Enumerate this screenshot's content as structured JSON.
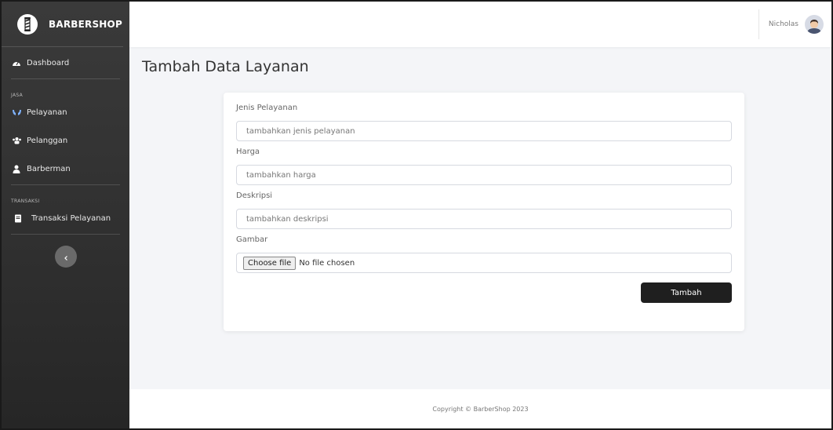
{
  "app": {
    "brand": "BARBERSHOP"
  },
  "sidebar": {
    "dashboard": "Dashboard",
    "heading_jasa": "JASA",
    "items_jasa": [
      "Pelayanan",
      "Pelanggan",
      "Barberman"
    ],
    "heading_transaksi": "TRANSAKSI",
    "items_transaksi": [
      "Transaksi Pelayanan"
    ]
  },
  "topbar": {
    "user_name": "Nicholas"
  },
  "page": {
    "title": "Tambah Data Layanan"
  },
  "form": {
    "jenis_label": "Jenis Pelayanan",
    "jenis_placeholder": "tambahkan jenis pelayanan",
    "harga_label": "Harga",
    "harga_placeholder": "tambahkan harga",
    "deskripsi_label": "Deskripsi",
    "deskripsi_placeholder": "tambahkan deskripsi",
    "gambar_label": "Gambar",
    "file_button": "Choose file",
    "file_status": "No file chosen",
    "submit": "Tambah"
  },
  "footer": {
    "text": "Copyright © BarberShop 2023"
  },
  "colors": {
    "sidebar_bg": "#333333",
    "primary_button": "#1f1f1f",
    "page_bg": "#f4f5f8"
  }
}
